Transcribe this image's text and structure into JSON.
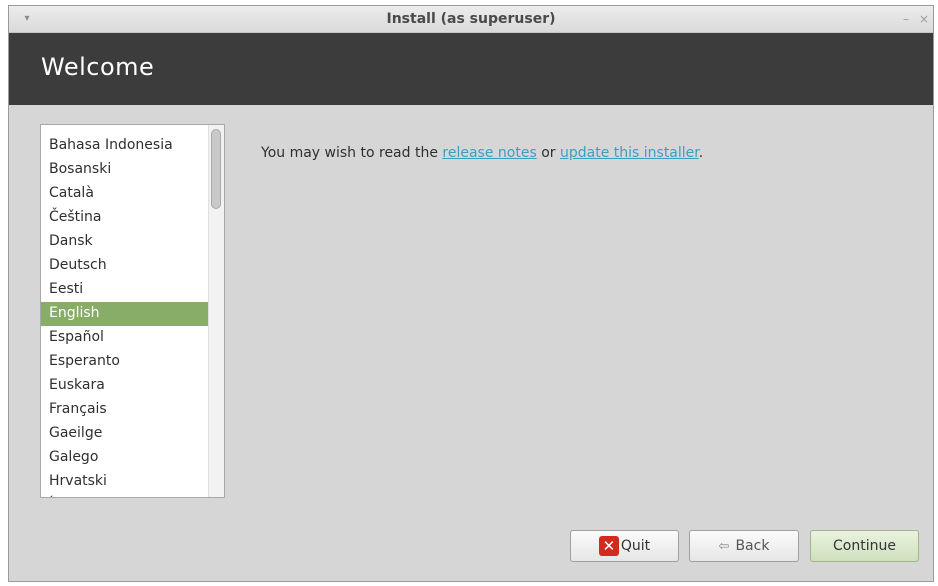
{
  "window": {
    "title": "Install (as superuser)",
    "menu_glyph": "▾",
    "minimize_glyph": "–",
    "close_glyph": "×"
  },
  "header": {
    "title": "Welcome"
  },
  "languages": {
    "selected": "English",
    "items": [
      "Bahasa Indonesia",
      "Bosanski",
      "Català",
      "Čeština",
      "Dansk",
      "Deutsch",
      "Eesti",
      "English",
      "Español",
      "Esperanto",
      "Euskara",
      "Français",
      "Gaeilge",
      "Galego",
      "Hrvatski",
      "Íslenska"
    ]
  },
  "message": {
    "prefix": "You may wish to read the ",
    "link1": "release notes",
    "middle": " or ",
    "link2": "update this installer",
    "suffix": "."
  },
  "buttons": {
    "quit_label": "Quit",
    "back_label": "Back",
    "continue_label": "Continue",
    "quit_icon": "✕",
    "back_icon": "⇦"
  },
  "colors": {
    "selected_row": "#87ad68",
    "link": "#3a9fbf",
    "header_bg": "#3c3c3c"
  }
}
